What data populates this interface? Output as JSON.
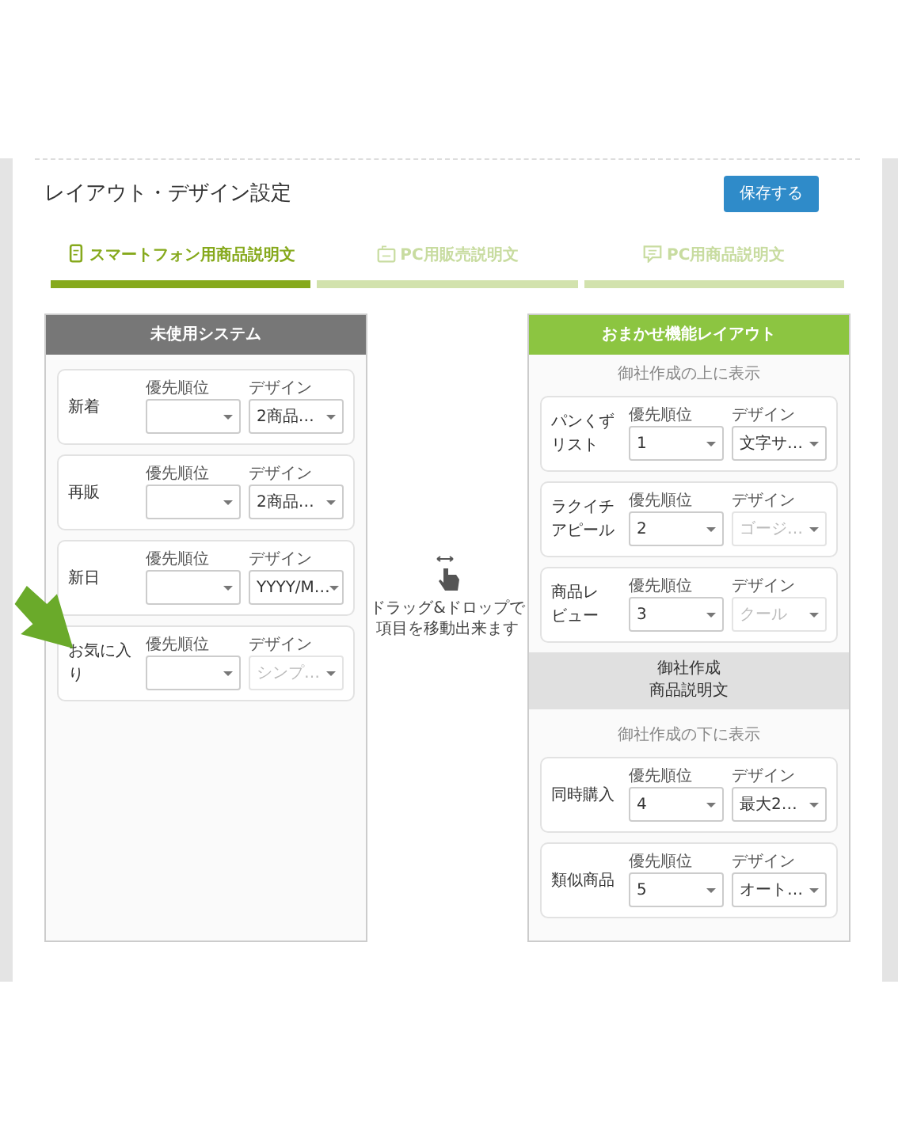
{
  "title": "レイアウト・デザイン設定",
  "save_button": "保存する",
  "tabs": [
    {
      "label": "スマートフォン用商品説明文",
      "selected": true
    },
    {
      "label": "PC用販売説明文",
      "selected": false
    },
    {
      "label": "PC用商品説明文",
      "selected": false
    }
  ],
  "unused": {
    "header": "未使用システム",
    "items": [
      {
        "label": "新着",
        "priority_caption": "優先順位",
        "design_caption": "デザイン",
        "design": "2商品…",
        "design_disabled": false
      },
      {
        "label": "再販",
        "priority_caption": "優先順位",
        "design_caption": "デザイン",
        "design": "2商品…",
        "design_disabled": false
      },
      {
        "label": "新日",
        "priority_caption": "優先順位",
        "design_caption": "デザイン",
        "design": "YYYY/M…",
        "design_disabled": false
      },
      {
        "label": "お気に入り",
        "priority_caption": "優先順位",
        "design_caption": "デザイン",
        "design": "シンプ…",
        "design_disabled": true
      }
    ]
  },
  "hint": "ドラッグ&ドロップで項目を移動出来ます",
  "layout": {
    "header": "おまかせ機能レイアウト",
    "sections": [
      {
        "kind": "note",
        "text": "御社作成の上に表示"
      },
      {
        "kind": "item",
        "label": "パンくずリスト",
        "priority_caption": "優先順位",
        "priority": "1",
        "design_caption": "デザイン",
        "design": "文字サ…",
        "design_disabled": false
      },
      {
        "kind": "item",
        "label": "ラクイチアピール",
        "priority_caption": "優先順位",
        "priority": "2",
        "design_caption": "デザイン",
        "design": "ゴージ…",
        "design_disabled": true
      },
      {
        "kind": "item",
        "label": "商品レビュー",
        "priority_caption": "優先順位",
        "priority": "3",
        "design_caption": "デザイン",
        "design": "クール",
        "design_disabled": true
      },
      {
        "kind": "block",
        "lines": [
          "御社作成",
          "商品説明文"
        ]
      },
      {
        "kind": "note",
        "text": "御社作成の下に表示"
      },
      {
        "kind": "item",
        "label": "同時購入",
        "priority_caption": "優先順位",
        "priority": "4",
        "design_caption": "デザイン",
        "design": "最大2…",
        "design_disabled": false
      },
      {
        "kind": "item",
        "label": "類似商品",
        "priority_caption": "優先順位",
        "priority": "5",
        "design_caption": "デザイン",
        "design": "オート…",
        "design_disabled": false
      }
    ]
  }
}
